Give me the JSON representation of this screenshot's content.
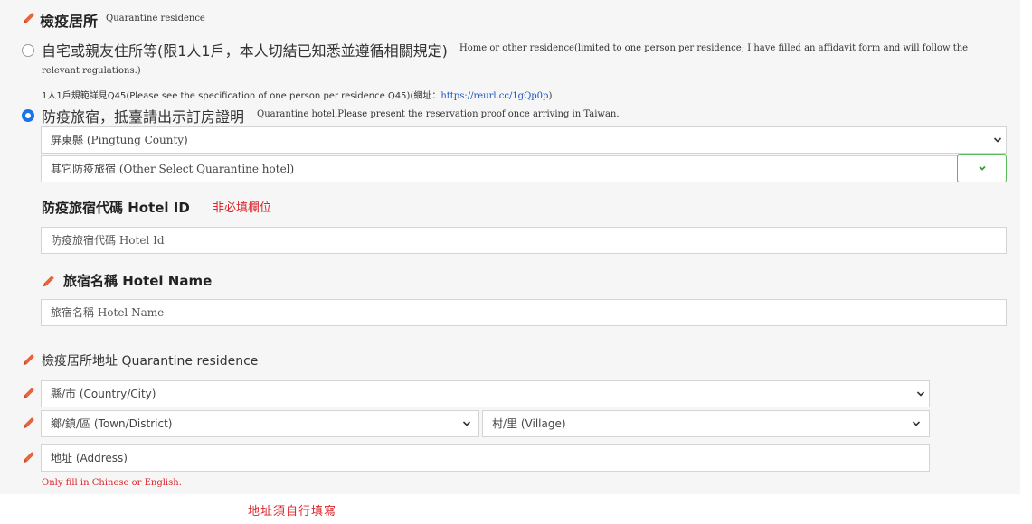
{
  "header": {
    "title_zh": "檢疫居所",
    "title_en": "Quarantine residence"
  },
  "options": {
    "home": {
      "label_zh": "自宅或親友住所等(限1人1戶，本人切結已知悉並遵循相關規定)",
      "label_en_line1": "Home or other residence(limited to one person per residence; I have filled an affidavit form and will follow the",
      "label_en_line2": "relevant regulations.)",
      "note_prefix": "1人1戶規範詳見Q45(Please see the specification of one person per residence Q45)(網址：",
      "note_link": "https://reurl.cc/1gQp0p",
      "note_suffix": ")",
      "selected": false
    },
    "hotel": {
      "label_zh": "防疫旅宿，抵臺請出示訂房證明",
      "label_en": "Quarantine hotel,Please present the reservation proof once arriving in Taiwan.",
      "selected": true
    }
  },
  "county_select": {
    "value": "屏東縣 (Pingtung County)"
  },
  "hotel_select": {
    "value": "其它防疫旅宿 (Other Select Quarantine hotel)"
  },
  "hotel_id": {
    "label": "防疫旅宿代碼 Hotel ID",
    "optional_note": "非必填欄位",
    "placeholder": "防疫旅宿代碼 Hotel Id"
  },
  "hotel_name": {
    "label": "旅宿名稱 Hotel Name",
    "placeholder": "旅宿名稱 Hotel Name"
  },
  "address_section": {
    "title": "檢疫居所地址 Quarantine residence",
    "city_placeholder": "縣/市 (Country/City)",
    "district_placeholder": "鄉/鎮/區 (Town/District)",
    "village_placeholder": "村/里 (Village)",
    "address_placeholder": "地址 (Address)",
    "hint": "Only fill in Chinese or English.",
    "self_fill_note": "地址須自行填寫"
  },
  "colors": {
    "pencil": "#e8643c",
    "radio_selected": "#1a73e8",
    "green_button": "#5cb85c",
    "note_red": "#d9262d"
  },
  "icons": [
    "pencil-icon",
    "chevron-down-icon"
  ]
}
